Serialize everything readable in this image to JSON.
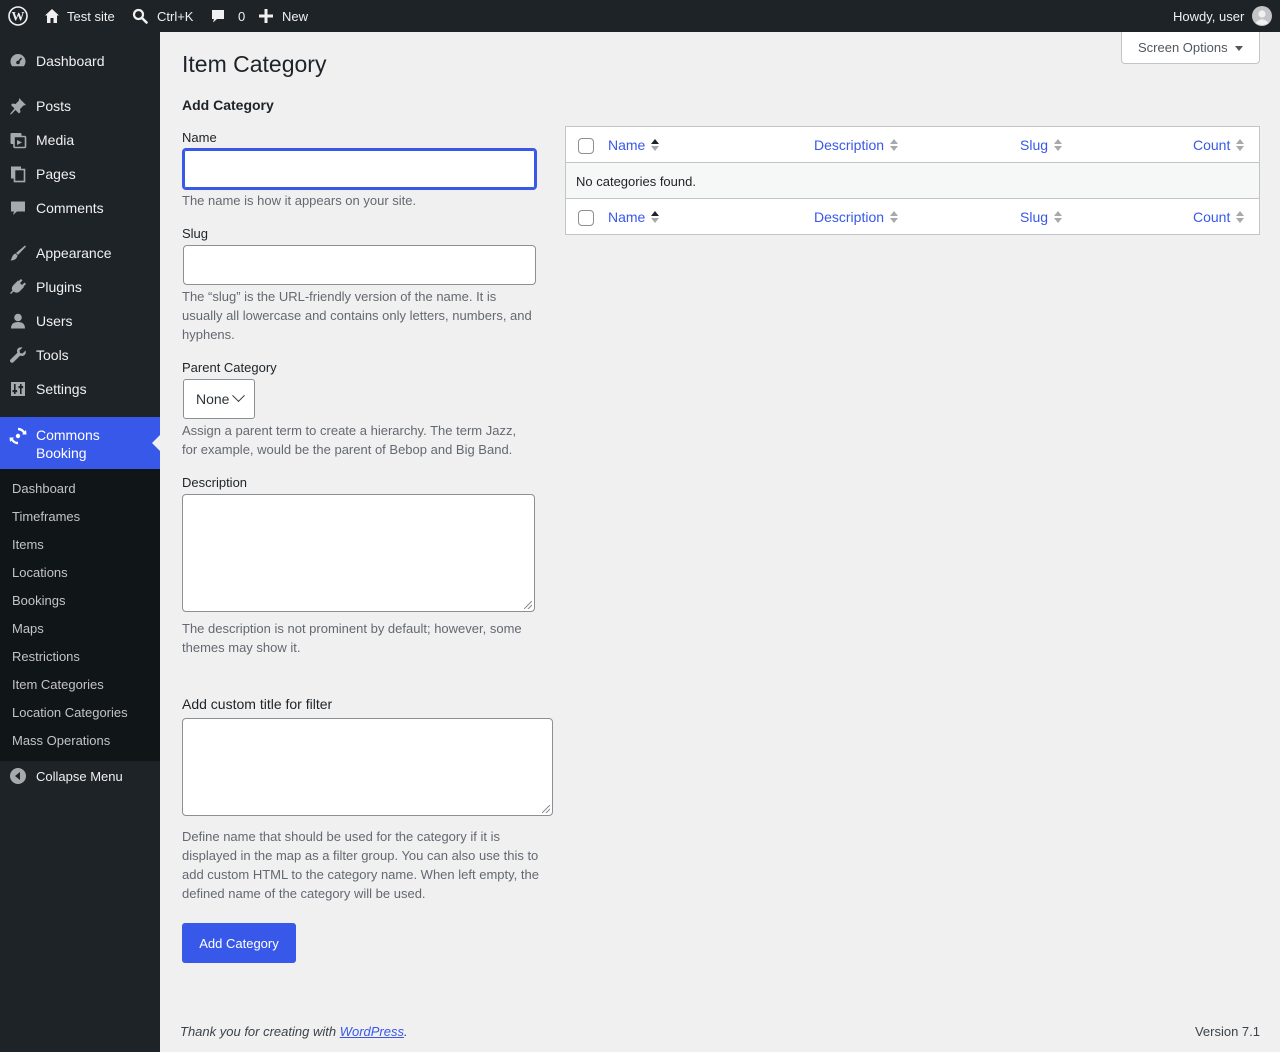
{
  "admin_bar": {
    "site_name": "Test site",
    "search_shortcut": "Ctrl+K",
    "comments_count": "0",
    "new_label": "New",
    "greeting": "Howdy, user"
  },
  "sidebar": {
    "items": [
      {
        "label": "Dashboard",
        "icon": "dashboard-icon"
      },
      {
        "label": "Posts",
        "icon": "pin-icon"
      },
      {
        "label": "Media",
        "icon": "media-icon"
      },
      {
        "label": "Pages",
        "icon": "pages-icon"
      },
      {
        "label": "Comments",
        "icon": "comment-icon"
      },
      {
        "label": "Appearance",
        "icon": "brush-icon"
      },
      {
        "label": "Plugins",
        "icon": "plug-icon"
      },
      {
        "label": "Users",
        "icon": "user-icon"
      },
      {
        "label": "Tools",
        "icon": "wrench-icon"
      },
      {
        "label": "Settings",
        "icon": "sliders-icon"
      }
    ],
    "current": {
      "label_line1": "Commons",
      "label_line2": "Booking",
      "icon": "sync-icon"
    },
    "submenu": [
      "Dashboard",
      "Timeframes",
      "Items",
      "Locations",
      "Bookings",
      "Maps",
      "Restrictions",
      "Item Categories",
      "Location Categories",
      "Mass Operations"
    ],
    "collapse_label": "Collapse Menu"
  },
  "page": {
    "title": "Item Category",
    "screen_options": "Screen Options"
  },
  "form": {
    "heading": "Add Category",
    "name_label": "Name",
    "name_value": "",
    "name_help": "The name is how it appears on your site.",
    "slug_label": "Slug",
    "slug_value": "",
    "slug_help_1": "The “slug” is the URL-friendly version of the name. It is",
    "slug_help_2": "usually all lowercase and contains only letters, numbers, and",
    "slug_help_3": "hyphens.",
    "parent_label": "Parent Category",
    "parent_value": "None",
    "parent_help_1": "Assign a parent term to create a hierarchy. The term Jazz,",
    "parent_help_2": "for example, would be the parent of Bebop and Big Band.",
    "description_label": "Description",
    "description_value": "",
    "description_help_1": "The description is not prominent by default; however, some",
    "description_help_2": "themes may show it.",
    "custom_title_label": "Add custom title for filter",
    "custom_title_value": "",
    "custom_title_help_1": "Define name that should be used for the category if it is",
    "custom_title_help_2": "displayed in the map as a filter group. You can also use this to",
    "custom_title_help_3": "add custom HTML to the category name. When left empty, the",
    "custom_title_help_4": "defined name of the category will be used.",
    "submit_label": "Add Category"
  },
  "table": {
    "columns": [
      "Name",
      "Description",
      "Slug",
      "Count"
    ],
    "empty_message": "No categories found.",
    "sorted_column": "Name"
  },
  "footer": {
    "thanks_prefix": "Thank you for creating with ",
    "thanks_link": "WordPress",
    "thanks_suffix": ".",
    "version": "Version 7.1"
  },
  "colors": {
    "accent": "#3858e9",
    "admin_bar_bg": "#1d2327",
    "submenu_bg": "#101517",
    "content_bg": "#f0f0f1"
  }
}
